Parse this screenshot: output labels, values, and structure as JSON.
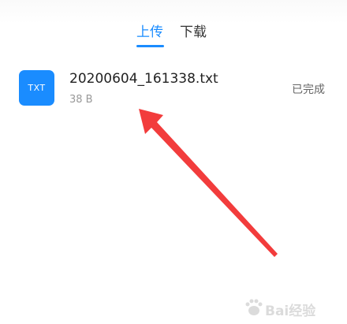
{
  "tabs": [
    {
      "label": "上传",
      "active": true
    },
    {
      "label": "下载",
      "active": false
    }
  ],
  "accent_color": "#1a8cff",
  "file": {
    "icon": "txt-file-icon",
    "icon_label": "TXT",
    "icon_color": "#1a8cff",
    "name": "20200604_161338.txt",
    "size": "38 B",
    "status": "已完成"
  },
  "annotation": {
    "arrow_color": "#f23c3c"
  },
  "watermark": {
    "text": "Bai经验"
  }
}
